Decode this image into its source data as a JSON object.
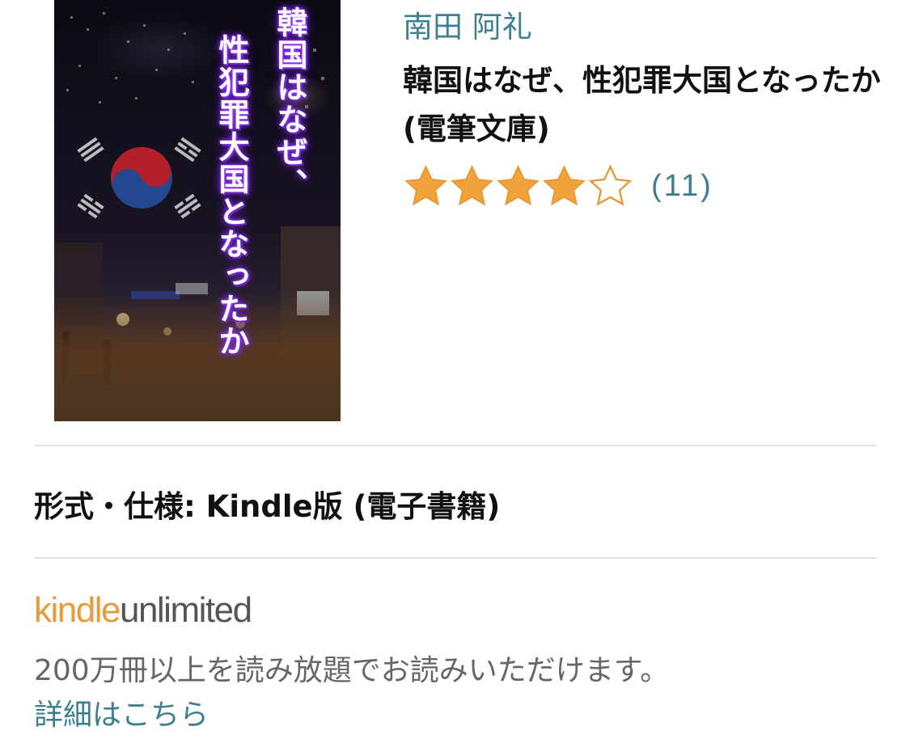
{
  "cover": {
    "title_line1": "韓国はなぜ、",
    "title_line2": "性犯罪大国となったか"
  },
  "product": {
    "author": "南田 阿礼",
    "title": "韓国はなぜ、性犯罪大国となったか (電筆文庫)",
    "rating": {
      "stars": 4,
      "max": 5,
      "count_label": "(11)",
      "star_color": "#f0a23b",
      "star_outline_color": "#e59a37"
    },
    "format": "形式・仕様: Kindle版 (電子書籍)"
  },
  "kindle_unlimited": {
    "logo_kindle": "kindle",
    "logo_unlimited": "unlimited",
    "description": "200万冊以上を読み放題でお読みいただけます。",
    "link": "詳細はこちら"
  },
  "colors": {
    "link": "#3c7f8f",
    "kindle_orange": "#e79a3b",
    "divider": "#e2e2e2"
  }
}
